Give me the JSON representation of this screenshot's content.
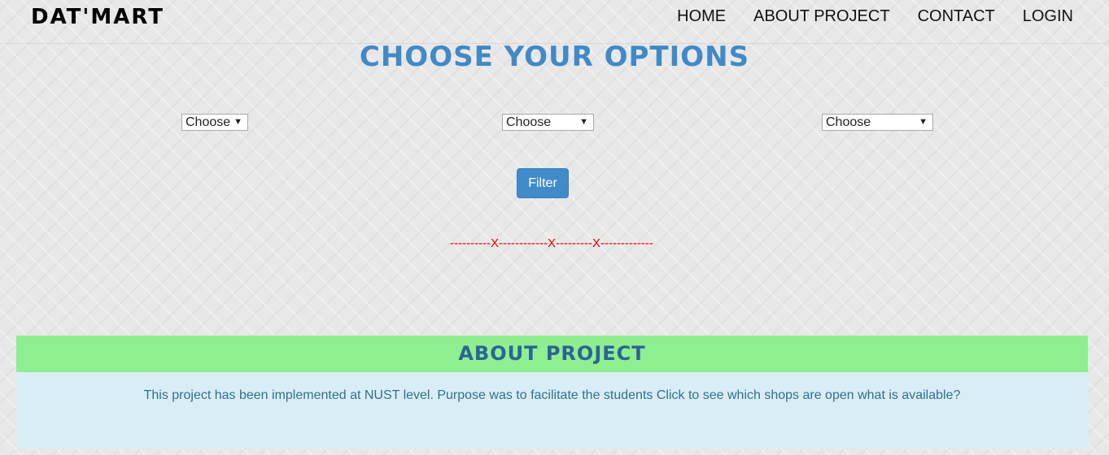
{
  "navbar": {
    "brand": "DAT'MART",
    "links": [
      "HOME",
      "ABOUT PROJECT",
      "CONTACT",
      "LOGIN"
    ]
  },
  "main": {
    "title": "CHOOSE YOUR OPTIONS",
    "selects": [
      {
        "selected": "Choose"
      },
      {
        "selected": "Choose"
      },
      {
        "selected": "Choose"
      }
    ],
    "filter_label": "Filter",
    "divider_text": "----------X------------X---------X-------------"
  },
  "about": {
    "heading": "ABOUT PROJECT",
    "text": "This project has been implemented at NUST level. Purpose was to facilitate the students Click to see which shops are open what is available?"
  },
  "colors": {
    "title": "#4189c7",
    "button": "#428bca",
    "about_header_bg": "#8fee8f",
    "about_body_bg": "#d9edf7",
    "divider": "#e00000"
  }
}
